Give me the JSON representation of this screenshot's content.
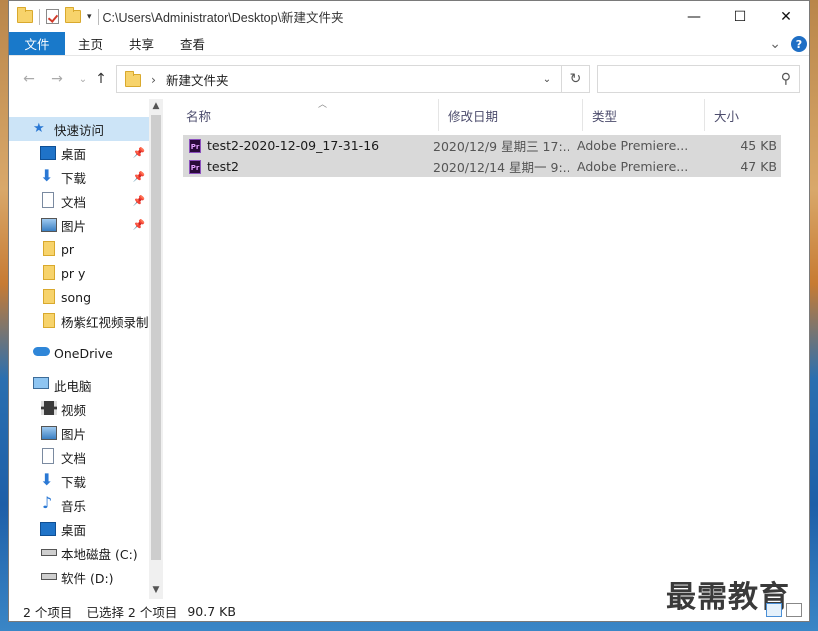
{
  "window": {
    "title_path": "C:\\Users\\Administrator\\Desktop\\新建文件夹",
    "minimize": "—",
    "maximize": "☐",
    "close": "✕"
  },
  "ribbon": {
    "tabs": [
      "文件",
      "主页",
      "共享",
      "查看"
    ],
    "expand": "⌄",
    "help": "?"
  },
  "nav": {
    "back": "←",
    "forward": "→",
    "recent": "⌄",
    "up": "↑",
    "address_crumb_sep": "›",
    "address_folder": "新建文件夹",
    "address_dropdown": "⌄",
    "refresh": "↻",
    "search_placeholder": "",
    "search_icon": "⚲"
  },
  "sidebar": {
    "items": [
      {
        "label": "快速访问",
        "icon": "star-icon"
      },
      {
        "label": "桌面",
        "icon": "desktop-icon",
        "pinned": true
      },
      {
        "label": "下载",
        "icon": "download-icon",
        "pinned": true
      },
      {
        "label": "文档",
        "icon": "document-icon",
        "pinned": true
      },
      {
        "label": "图片",
        "icon": "picture-icon",
        "pinned": true
      },
      {
        "label": "pr",
        "icon": "folder-icon"
      },
      {
        "label": "pr y",
        "icon": "folder-icon"
      },
      {
        "label": "song",
        "icon": "folder-icon"
      },
      {
        "label": "杨紫红视频录制",
        "icon": "folder-icon"
      },
      {
        "label": "OneDrive",
        "icon": "cloud-icon"
      },
      {
        "label": "此电脑",
        "icon": "computer-icon"
      },
      {
        "label": "视频",
        "icon": "video-icon"
      },
      {
        "label": "图片",
        "icon": "picture-icon"
      },
      {
        "label": "文档",
        "icon": "document-icon"
      },
      {
        "label": "下载",
        "icon": "download-icon"
      },
      {
        "label": "音乐",
        "icon": "music-icon"
      },
      {
        "label": "桌面",
        "icon": "desktop-icon"
      },
      {
        "label": "本地磁盘 (C:)",
        "icon": "drive-icon"
      },
      {
        "label": "软件 (D:)",
        "icon": "drive-icon"
      }
    ]
  },
  "columns": {
    "name": "名称",
    "modified": "修改日期",
    "type": "类型",
    "size": "大小"
  },
  "files": [
    {
      "name": "test2-2020-12-09_17-31-16",
      "modified": "2020/12/9 星期三 17:...",
      "type": "Adobe Premiere...",
      "size": "45 KB"
    },
    {
      "name": "test2",
      "modified": "2020/12/14 星期一 9:...",
      "type": "Adobe Premiere...",
      "size": "47 KB"
    }
  ],
  "status": {
    "count": "2 个项目",
    "selected": "已选择 2 个项目",
    "size": "90.7 KB"
  },
  "watermark": "最需教育",
  "file_icon_text": "Pr"
}
